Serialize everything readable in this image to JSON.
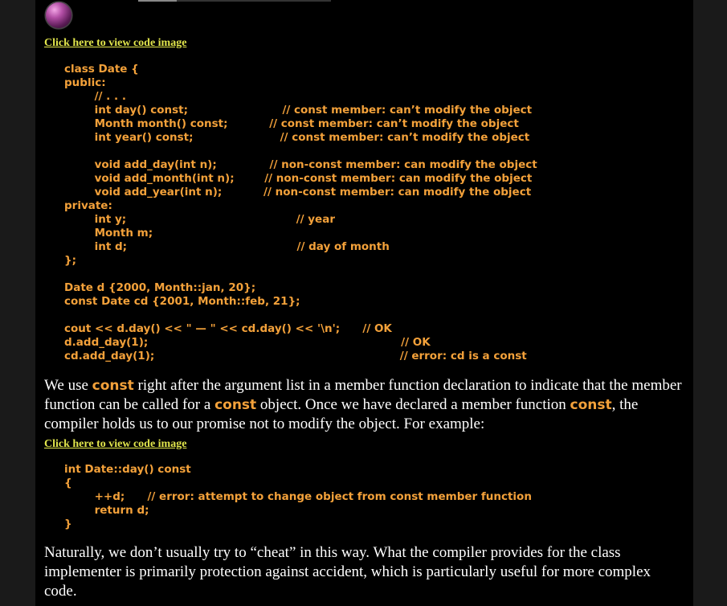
{
  "link_text": "Click here to view code image",
  "code1": [
    "class Date {",
    "public:",
    "        // . . .",
    "        int day() const;                         // const member: can’t modify the object",
    "        Month month() const;           // const member: can’t modify the object",
    "        int year() const;                       // const member: can’t modify the object",
    "",
    "        void add_day(int n);              // non-const member: can modify the object",
    "        void add_month(int n);        // non-const member: can modify the object",
    "        void add_year(int n);           // non-const member: can modify the object",
    "private:",
    "        int y;                                             // year",
    "        Month m;",
    "        int d;                                             // day of month",
    "};",
    "",
    "Date d {2000, Month::jan, 20};",
    "const Date cd {2001, Month::feb, 21};",
    "",
    "cout << d.day() << \" — \" << cd.day() << '\\n';      // OK",
    "d.add_day(1);                                                                   // OK",
    "cd.add_day(1);                                                                 // error: cd is a const"
  ],
  "para1": {
    "t1": "We use ",
    "k1": "const",
    "t2": " right after the argument list in a member function declaration to indicate that the member function can be called for a ",
    "k2": "const",
    "t3": " object. Once we have declared a member function ",
    "k3": "const",
    "t4": ", the compiler holds us to our promise not to modify the object. For example:"
  },
  "code2": [
    "int Date::day() const",
    "{",
    "        ++d;      // error: attempt to change object from const member function",
    "        return d;",
    "}"
  ],
  "para2": "Naturally, we don’t usually try to “cheat” in this way. What the compiler provides for the class implementer is primarily protection against accident, which is particularly useful for more complex code."
}
